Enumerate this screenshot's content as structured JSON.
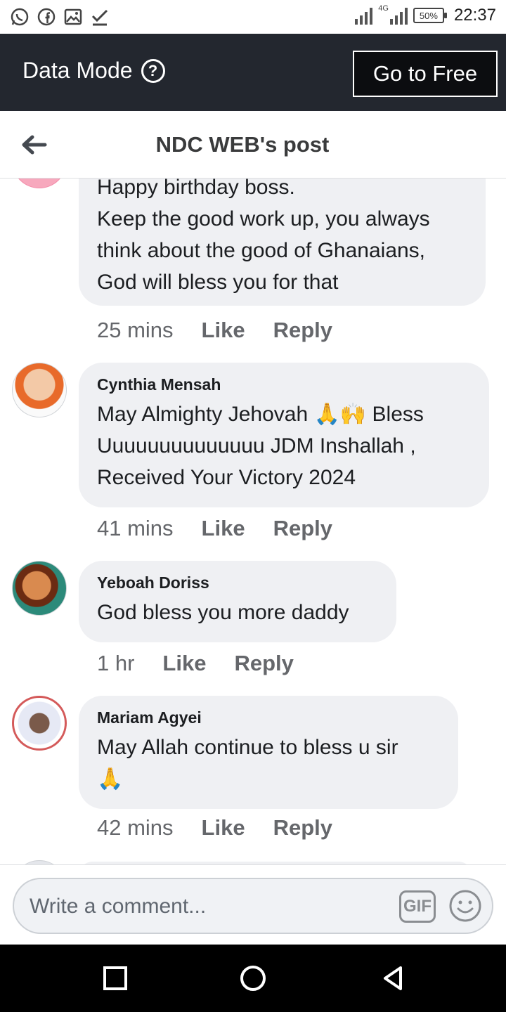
{
  "status_bar": {
    "network": "4G",
    "battery": "50%",
    "time": "22:37"
  },
  "data_mode": {
    "label": "Data Mode",
    "help_symbol": "?",
    "go_free_label": "Go to Free"
  },
  "header": {
    "title": "NDC WEB's post"
  },
  "comments": [
    {
      "author": "",
      "lines": [
        "Happy birthday boss.",
        "Keep the good work up, you always",
        "think about the good of Ghanaians,",
        "God will bless you for that"
      ],
      "time": "25 mins",
      "like": "Like",
      "reply": "Reply"
    },
    {
      "author": "Cynthia Mensah",
      "lines": [
        "May Almighty Jehovah 🙏🙌 Bless",
        "Uuuuuuuuuuuuuu JDM Inshallah ,",
        "Received Your Victory 2024"
      ],
      "time": "41 mins",
      "like": "Like",
      "reply": "Reply"
    },
    {
      "author": "Yeboah Doriss",
      "lines": [
        "God bless you more daddy"
      ],
      "time": "1 hr",
      "like": "Like",
      "reply": "Reply"
    },
    {
      "author": "Mariam Agyei",
      "lines": [
        "May Allah continue to bless u sir",
        "🙏"
      ],
      "time": "42 mins",
      "like": "Like",
      "reply": "Reply"
    }
  ],
  "composer": {
    "placeholder": "Write a comment...",
    "gif_label": "GIF"
  },
  "icons": {
    "status_left": [
      "whatsapp-icon",
      "facebook-icon",
      "gallery-icon",
      "check-icon"
    ],
    "nav": [
      "recent-apps-icon",
      "home-icon",
      "back-triangle-icon"
    ]
  }
}
